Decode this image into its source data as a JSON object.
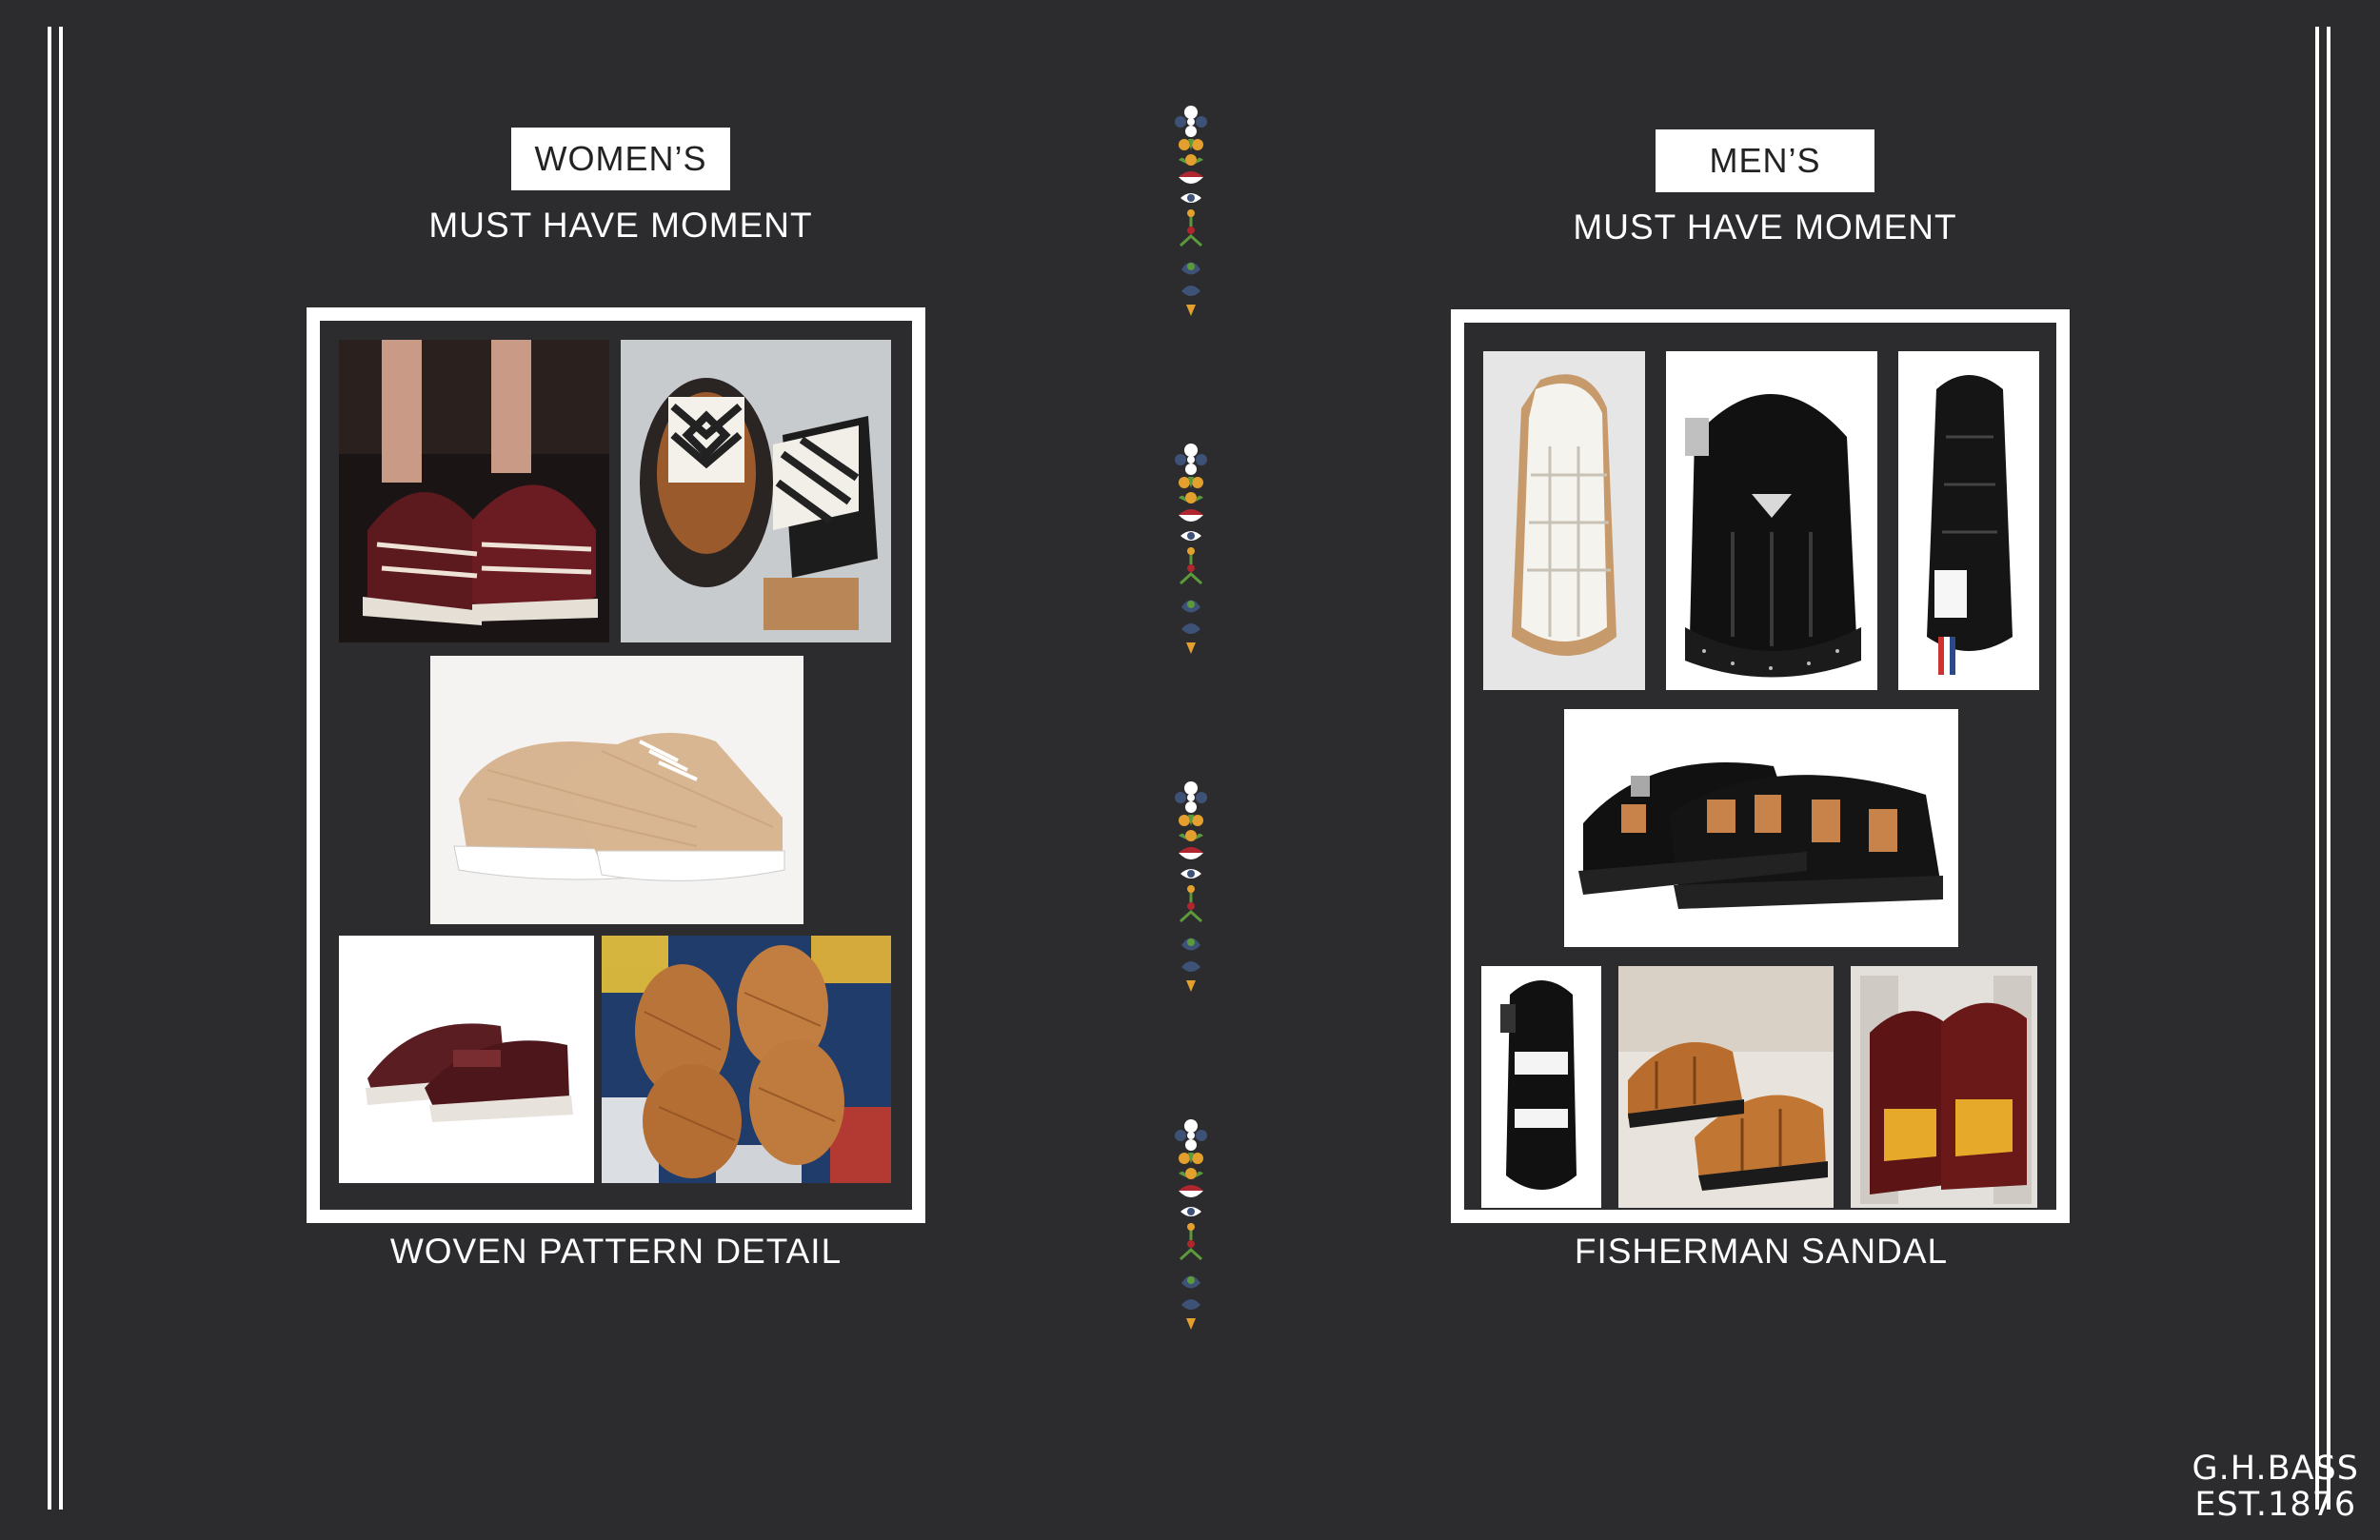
{
  "women": {
    "tag": "WOMEN’S",
    "subtitle": "MUST HAVE MOMENT",
    "caption": "WOVEN PATTERN DETAIL",
    "photos": [
      "burgundy-caged-sandal-photo",
      "woven-platform-mule-photo",
      "woven-tan-sneaker-photo",
      "burgundy-woven-loafer-photo",
      "woven-leather-mules-photo"
    ]
  },
  "men": {
    "tag": "MEN’S",
    "subtitle": "MUST HAVE MOMENT",
    "caption": "FISHERMAN SANDAL",
    "photos": [
      "white-fisherman-sandal-photo",
      "black-platform-fisherman-sandal-photo",
      "black-fisherman-sandal-side-photo",
      "black-fisherman-sandal-pair-photo",
      "black-strap-sandal-photo",
      "tan-fisherman-sandals-photo",
      "burgundy-sandals-photo"
    ]
  },
  "brand": {
    "line1": "G.H.BASS",
    "line2": "EST.1876"
  },
  "colors": {
    "background": "#2c2b2e",
    "frame": "#ffffff",
    "accent_red": "#b0262e",
    "accent_orange": "#e4a02e",
    "accent_green": "#5b9a3b",
    "accent_navy": "#3d5276"
  }
}
